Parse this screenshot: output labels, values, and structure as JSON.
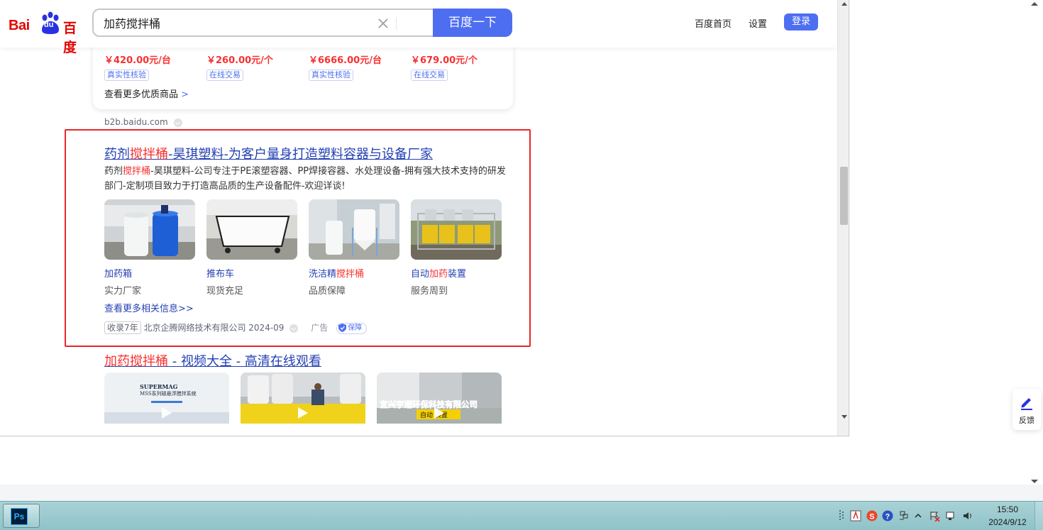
{
  "header": {
    "logo_latin": "Bai",
    "logo_du": "du",
    "logo_cn": "百度",
    "search_value": "加药搅拌桶",
    "search_button": "百度一下",
    "nav_home": "百度首页",
    "nav_settings": "设置",
    "login": "登录"
  },
  "shopping": {
    "items": [
      {
        "price": "￥420.00元/台",
        "tag": "真实性核验"
      },
      {
        "price": "￥260.00元/个",
        "tag": "在线交易"
      },
      {
        "price": "￥6666.00元/台",
        "tag": "真实性核验"
      },
      {
        "price": "￥679.00元/个",
        "tag": "在线交易"
      }
    ],
    "more": "查看更多优质商品",
    "more_arrow": ">",
    "source": "b2b.baidu.com"
  },
  "ad_result": {
    "title_prefix": "药剂",
    "title_highlight": "搅拌桶",
    "title_suffix": "-昊琪塑料-为客户量身打造塑料容器与设备厂家",
    "desc_prefix": "药剂",
    "desc_highlight": "搅拌桶",
    "desc_suffix": "-昊琪塑料-公司专注于PE滚塑容器、PP焊接容器、水处理设备-拥有强大技术支持的研发部门-定制项目致力于打造高品质的生产设备配件-欢迎详谈!",
    "products": [
      {
        "name_plain": "加药箱",
        "name_hl": "",
        "name_tail": "",
        "sub": "实力厂家"
      },
      {
        "name_plain": "推布车",
        "name_hl": "",
        "name_tail": "",
        "sub": "现货充足"
      },
      {
        "name_plain": "洗洁精",
        "name_hl": "搅拌桶",
        "name_tail": "",
        "sub": "品质保障"
      },
      {
        "name_plain": "自动",
        "name_hl": "加药",
        "name_tail": "装置",
        "sub": "服务周到"
      }
    ],
    "more": "查看更多相关信息>>",
    "badge_years": "收录7年",
    "company": "北京企腾网络技术有限公司 2024-09",
    "ad_label": "广告",
    "guarantee": "保障"
  },
  "video_result": {
    "title_highlight": "加药搅拌桶",
    "title_suffix": " - 视频大全 - 高清在线观看",
    "thumb1_line1": "SUPERMAG",
    "thumb1_line2": "MSS系列磁悬浮搅拌系统",
    "thumb3_line1": "宜兴宇潮环保科技有限公司",
    "thumb3_line2": "自动  装置"
  },
  "feedback": {
    "label": "反馈"
  },
  "taskbar": {
    "ps_label": "Ps",
    "time": "15:50",
    "date": "2024/9/12"
  },
  "colors": {
    "brand_blue": "#4e6ef2",
    "link_blue": "#2440b3",
    "highlight_red": "#f73131",
    "baidu_red": "#e10601",
    "annotation_red": "#e8262a"
  }
}
